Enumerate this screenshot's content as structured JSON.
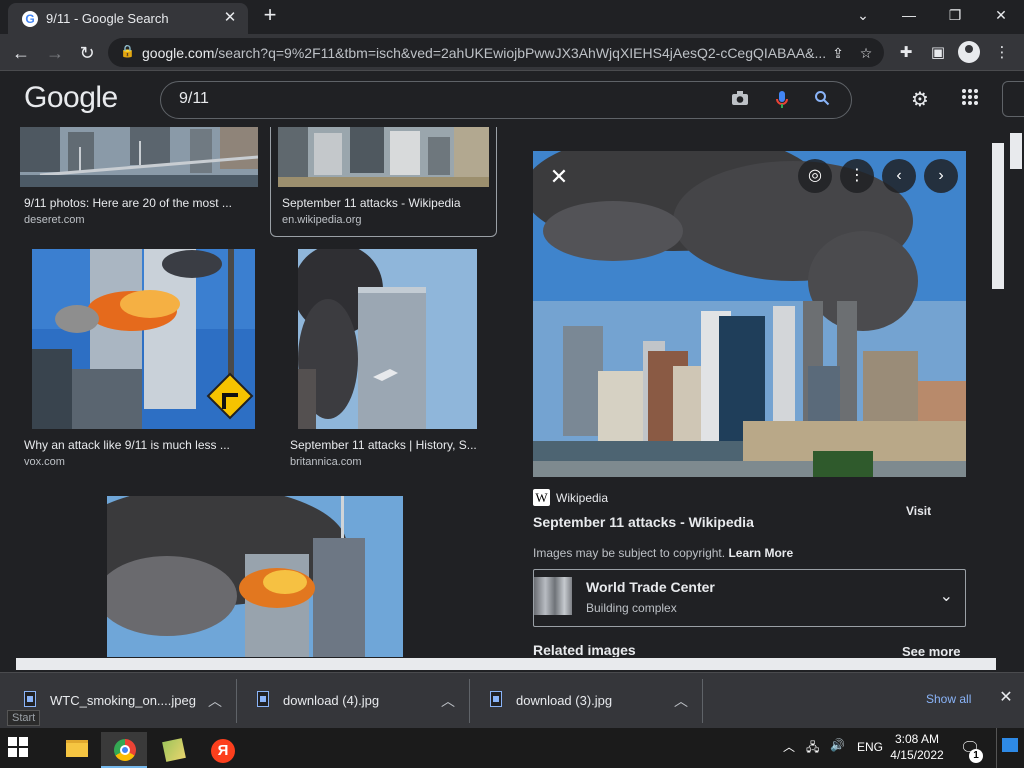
{
  "browser": {
    "tab_title": "9/11 - Google Search",
    "tab_favicon": "G",
    "url_host": "google.com",
    "url_path": "/search?q=9%2F11&tbm=isch&ved=2ahUKEwiojbPwwJX3AhWjqXIEHS4jAesQ2-cCegQIABAA&..."
  },
  "google": {
    "logo": "Google",
    "query": "9/11"
  },
  "results": [
    {
      "caption": "9/11 photos: Here are 20 of the most ...",
      "source": "deseret.com"
    },
    {
      "caption": "September 11 attacks - Wikipedia",
      "source": "en.wikipedia.org"
    },
    {
      "caption": "Why an attack like 9/11 is much less ...",
      "source": "vox.com"
    },
    {
      "caption": "September 11 attacks | History, S...",
      "source": "britannica.com"
    }
  ],
  "panel": {
    "site_icon": "W",
    "site_name": "Wikipedia",
    "visit_label": "Visit",
    "title": "September 11 attacks - Wikipedia",
    "copyright_text": "Images may be subject to copyright. ",
    "learn_more": "Learn More",
    "entity_title": "World Trade Center",
    "entity_sub": "Building complex",
    "related_label": "Related images",
    "see_more": "See more"
  },
  "downloads": {
    "files": [
      "WTC_smoking_on....jpeg",
      "download (4).jpg",
      "download (3).jpg"
    ],
    "show_all": "Show all"
  },
  "taskbar": {
    "tooltip": "Start",
    "yandex_letter": "Я",
    "lang": "ENG",
    "time": "3:08 AM",
    "date": "4/15/2022",
    "notification_count": "1"
  },
  "colors": {
    "bg": "#202124",
    "chrome_toolbar": "#35363a",
    "link_blue": "#8ab4f8",
    "text": "#e8eaed"
  }
}
